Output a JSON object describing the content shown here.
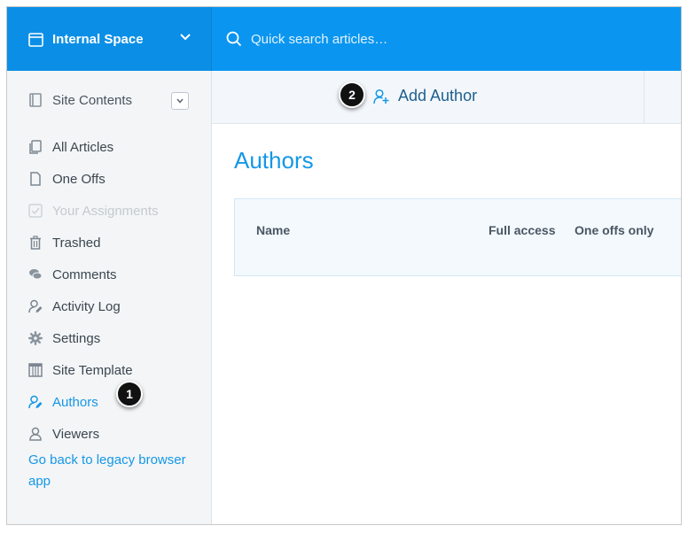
{
  "topbar": {
    "space_name": "Internal Space",
    "search_placeholder": "Quick search articles…"
  },
  "sidebar": {
    "site_contents_label": "Site Contents",
    "items": [
      {
        "label": "All Articles",
        "icon": "copy-icon"
      },
      {
        "label": "One Offs",
        "icon": "document-icon"
      },
      {
        "label": "Your Assignments",
        "icon": "checkbox-icon",
        "disabled": true
      },
      {
        "label": "Trashed",
        "icon": "trash-icon"
      },
      {
        "label": "Comments",
        "icon": "comments-icon"
      },
      {
        "label": "Activity Log",
        "icon": "user-edit-icon"
      },
      {
        "label": "Settings",
        "icon": "gear-icon"
      },
      {
        "label": "Site Template",
        "icon": "template-icon"
      },
      {
        "label": "Authors",
        "icon": "author-icon",
        "active": true
      },
      {
        "label": "Viewers",
        "icon": "user-icon"
      }
    ],
    "legacy_link": "Go back to legacy browser app"
  },
  "action_bar": {
    "add_author_label": "Add Author"
  },
  "main": {
    "title": "Authors",
    "table_headers": {
      "name": "Name",
      "full_access": "Full access",
      "one_offs_only": "One offs only"
    }
  },
  "callouts": {
    "one": "1",
    "two": "2"
  },
  "colors": {
    "accent": "#1497e6",
    "topbar": "#0a96f0",
    "sidebar_bg": "#f3f5f7"
  }
}
